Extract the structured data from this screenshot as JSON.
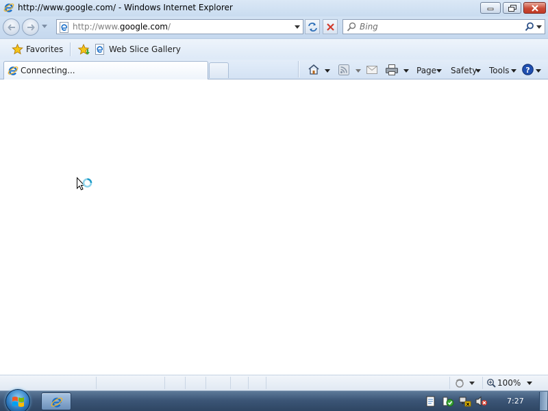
{
  "window": {
    "title": "http://www.google.com/ - Windows Internet Explorer",
    "buttons": {
      "minimize": "minimize-icon",
      "maximize": "restore-icon",
      "close": "close-icon"
    }
  },
  "address": {
    "url_prefix": "http://www.",
    "url_domain": "google.com",
    "url_suffix": "/"
  },
  "search": {
    "placeholder": "Bing"
  },
  "favorites_bar": {
    "favorites_label": "Favorites",
    "web_slice_label": "Web Slice Gallery"
  },
  "tab": {
    "label": "Connecting..."
  },
  "command_bar": {
    "page_label": "Page",
    "safety_label": "Safety",
    "tools_label": "Tools"
  },
  "status_bar": {
    "text": "",
    "zoom": "100%"
  },
  "taskbar": {
    "clock": "7:27"
  },
  "colors": {
    "close_red": "#c94a36",
    "ie_blue": "#1a6fc9",
    "stop_red": "#d03a2c",
    "taskbar": "#3c5677"
  }
}
